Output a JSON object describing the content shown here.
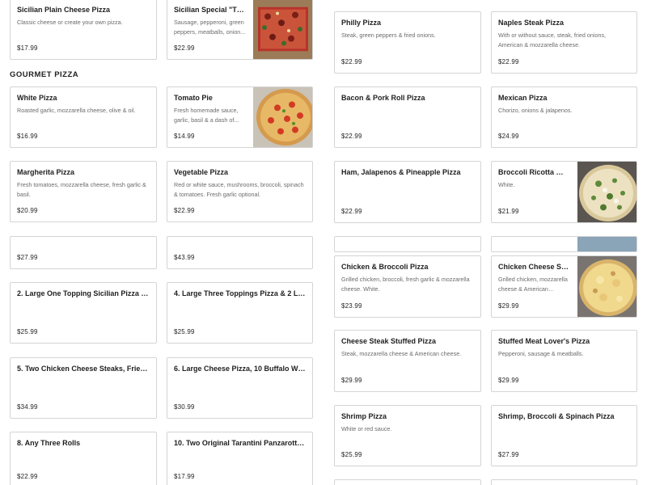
{
  "section": {
    "title": "GOURMET PIZZA"
  },
  "items": [
    {
      "id": "sicilian-plain",
      "name": "Sicilian Plain Cheese Pizza",
      "desc": "Classic cheese or create your own pizza.",
      "price": "$17.99"
    },
    {
      "id": "sicilian-special",
      "name": "Sicilian Special \"The...",
      "desc": "Sausage, pepperoni, green peppers, meatballs, onion...",
      "price": "$22.99",
      "image": "sicilian-square-pizza"
    },
    {
      "id": "white-pizza",
      "name": "White Pizza",
      "desc": "Roasted garlic, mozzarella cheese, olive & oil.",
      "price": "$16.99"
    },
    {
      "id": "tomato-pie",
      "name": "Tomato Pie",
      "desc": "Fresh homemade sauce, garlic, basil & a dash of...",
      "price": "$14.99",
      "image": "tomato-pie"
    },
    {
      "id": "margherita",
      "name": "Margherita Pizza",
      "desc": "Fresh tomatoes, mozzarella cheese, fresh garlic & basil.",
      "price": "$20.99"
    },
    {
      "id": "vegetable",
      "name": "Vegetable Pizza",
      "desc": "Red or white sauce, mushrooms, broccoli, spinach & tomatoes. Fresh garlic optional.",
      "price": "$22.99"
    },
    {
      "id": "left-r4-a",
      "name": "",
      "desc": "",
      "price": "$27.99"
    },
    {
      "id": "left-r4-b",
      "name": "",
      "desc": "",
      "price": "$43.99"
    },
    {
      "id": "special-2",
      "name": "2. Large One Topping Sicilian Pizza & 2 Liter...",
      "desc": "",
      "price": "$25.99"
    },
    {
      "id": "special-4",
      "name": "4. Large Three Toppings Pizza & 2 Liter...",
      "desc": "",
      "price": "$25.99"
    },
    {
      "id": "special-5",
      "name": "5. Two Chicken Cheese Steaks, Fries,...",
      "desc": "",
      "price": "$34.99"
    },
    {
      "id": "special-6",
      "name": "6. Large Cheese Pizza, 10 Buffalo Wings &...",
      "desc": "",
      "price": "$30.99"
    },
    {
      "id": "special-8",
      "name": "8. Any Three Rolls",
      "desc": "",
      "price": "$22.99"
    },
    {
      "id": "special-10",
      "name": "10. Two Original Tarantini Panzarottis & Fr...",
      "desc": "",
      "price": "$17.99"
    },
    {
      "id": "philly",
      "name": "Philly Pizza",
      "desc": "Steak, green peppers & fried onions.",
      "price": "$22.99"
    },
    {
      "id": "naples-steak",
      "name": "Naples Steak Pizza",
      "desc": "With or without sauce, steak, fried onions, American & mozzarella cheese.",
      "price": "$22.99"
    },
    {
      "id": "bacon-pork-roll",
      "name": "Bacon & Pork Roll Pizza",
      "desc": "",
      "price": "$22.99"
    },
    {
      "id": "mexican",
      "name": "Mexican Pizza",
      "desc": "Chorizo, onions & jalapenos.",
      "price": "$24.99"
    },
    {
      "id": "ham-jalapeno-pineapple",
      "name": "Ham, Jalapenos & Pineapple Pizza",
      "desc": "",
      "price": "$22.99"
    },
    {
      "id": "broccoli-ricotta",
      "name": "Broccoli Ricotta White...",
      "desc": "White.",
      "price": "$21.99",
      "image": "broccoli-ricotta-pizza"
    },
    {
      "id": "chicken-broccoli",
      "name": "Chicken & Broccoli Pizza",
      "desc": "Grilled chicken, broccoli, fresh garlic & mozzarella cheese. White.",
      "price": "$23.99"
    },
    {
      "id": "chicken-cheese-steak",
      "name": "Chicken Cheese Steak...",
      "desc": "Grilled chicken, mozzarella cheese & American cheese.",
      "price": "$29.99",
      "image": "chicken-cheese-steak-pizza"
    },
    {
      "id": "cheese-steak-stuffed",
      "name": "Cheese Steak Stuffed Pizza",
      "desc": "Steak, mozzarella cheese & American cheese.",
      "price": "$29.99"
    },
    {
      "id": "stuffed-meat-lovers",
      "name": "Stuffed Meat Lover's Pizza",
      "desc": "Pepperoni, sausage & meatballs.",
      "price": "$29.99"
    },
    {
      "id": "shrimp",
      "name": "Shrimp Pizza",
      "desc": "White or red sauce.",
      "price": "$25.99"
    },
    {
      "id": "shrimp-broccoli-spinach",
      "name": "Shrimp, Broccoli & Spinach Pizza",
      "desc": "",
      "price": "$27.99"
    }
  ],
  "colors": {
    "border": "#d4d4d4",
    "text": "#1f1f1f",
    "muted": "#6b6b6b"
  }
}
